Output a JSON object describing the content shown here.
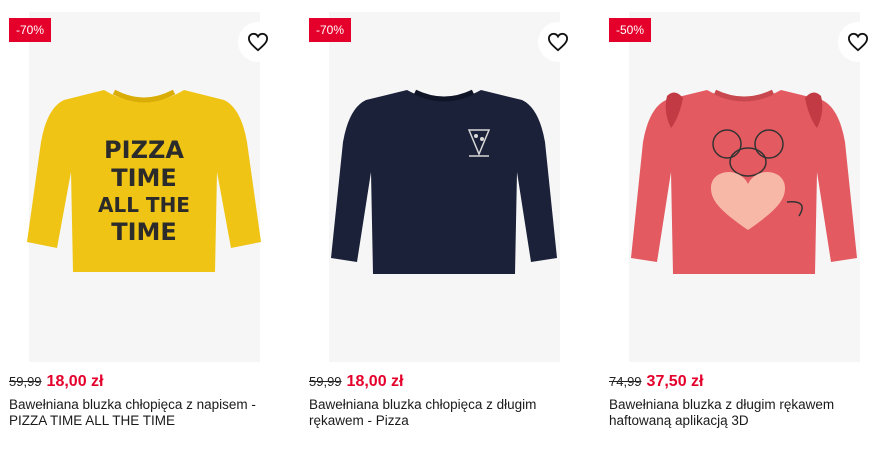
{
  "products": [
    {
      "badge": "-70%",
      "old_price": "59,99",
      "new_price": "18,00 zł",
      "title": "Bawełniana bluzka chłopięca z napisem - PIZZA TIME ALL THE TIME",
      "print_lines": [
        "PIZZA",
        "TIME",
        "ALL THE",
        "TIME"
      ],
      "shirt_color": "#f0c414",
      "print_color": "#2b2b2b"
    },
    {
      "badge": "-70%",
      "old_price": "59,99",
      "new_price": "18,00 zł",
      "title": "Bawełniana bluzka chłopięca z długim rękawem - Pizza",
      "shirt_color": "#1a2138",
      "print_color": "#d8d8d8"
    },
    {
      "badge": "-50%",
      "old_price": "74,99",
      "new_price": "37,50 zł",
      "title": "Bawełniana bluzka z długim rękawem haftowaną aplikacją 3D",
      "shirt_color": "#e35a61",
      "print_color": "#f7b8a8"
    }
  ],
  "colors": {
    "sale_red": "#e4002b",
    "image_bg": "#f6f6f6"
  },
  "icons": {
    "favorite": "heart-outline-icon"
  }
}
